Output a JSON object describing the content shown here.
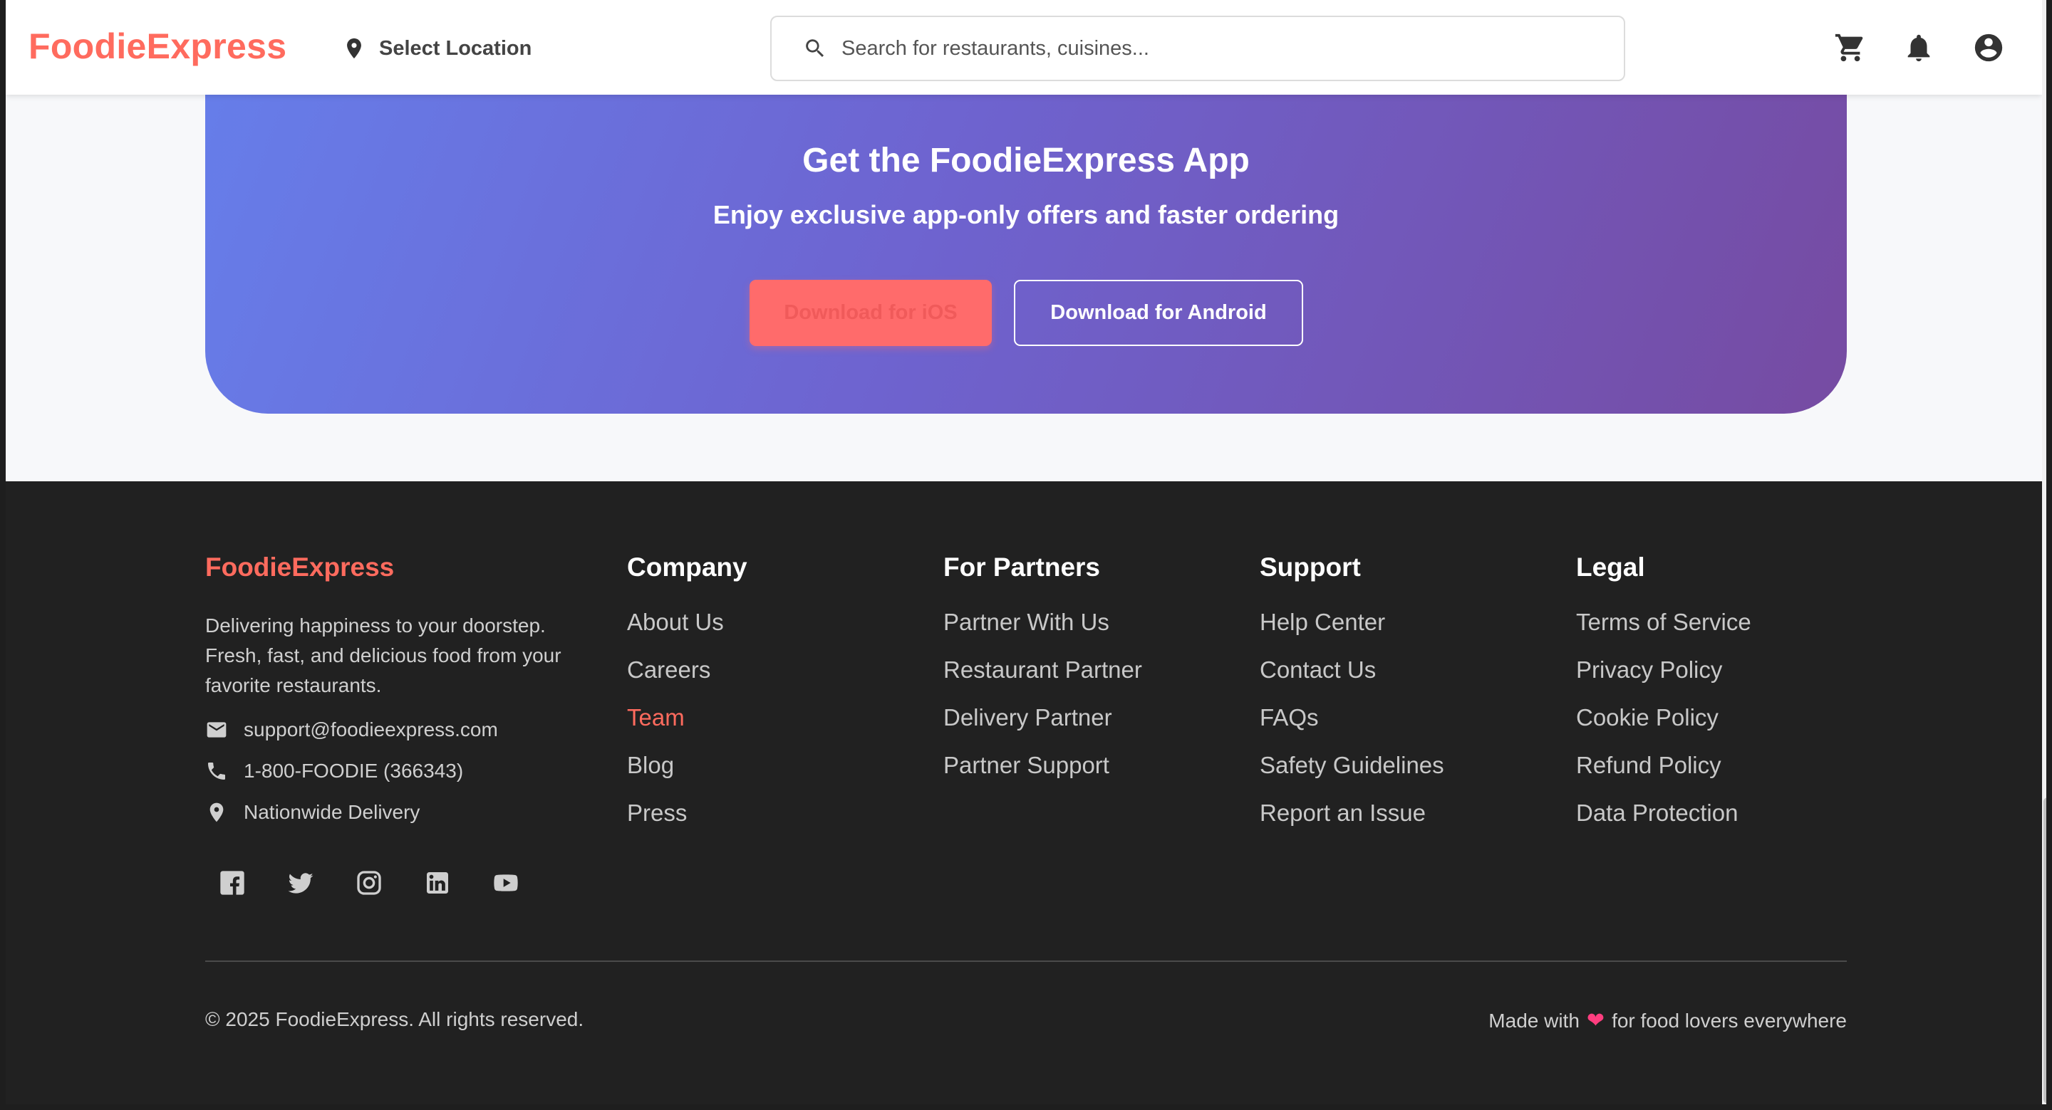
{
  "header": {
    "logo": "FoodieExpress",
    "location_label": "Select Location",
    "search_placeholder": "Search for restaurants, cuisines..."
  },
  "banner": {
    "title": "Get the FoodieExpress App",
    "subtitle": "Enjoy exclusive app-only offers and faster ordering",
    "ios_label": "Download for iOS",
    "android_label": "Download for Android"
  },
  "footer": {
    "brand": "FoodieExpress",
    "tagline": "Delivering happiness to your doorstep. Fresh, fast, and delicious food from your favorite restaurants.",
    "email": "support@foodieexpress.com",
    "phone": "1-800-FOODIE (366343)",
    "delivery": "Nationwide Delivery",
    "columns": [
      {
        "title": "Company",
        "links": [
          "About Us",
          "Careers",
          "Team",
          "Blog",
          "Press"
        ]
      },
      {
        "title": "For Partners",
        "links": [
          "Partner With Us",
          "Restaurant Partner",
          "Delivery Partner",
          "Partner Support"
        ]
      },
      {
        "title": "Support",
        "links": [
          "Help Center",
          "Contact Us",
          "FAQs",
          "Safety Guidelines",
          "Report an Issue"
        ]
      },
      {
        "title": "Legal",
        "links": [
          "Terms of Service",
          "Privacy Policy",
          "Cookie Policy",
          "Refund Policy",
          "Data Protection"
        ]
      }
    ],
    "copyright": "© 2025 FoodieExpress. All rights reserved.",
    "made_prefix": "Made with",
    "made_suffix": "for food lovers everywhere"
  },
  "colors": {
    "brand": "#ff6b5e",
    "banner_start": "#667eea",
    "banner_end": "#764ba2",
    "footer_bg": "#212121"
  },
  "icons": [
    "location-pin-icon",
    "search-icon",
    "cart-icon",
    "bell-icon",
    "account-icon",
    "email-icon",
    "phone-icon",
    "facebook-icon",
    "twitter-icon",
    "instagram-icon",
    "linkedin-icon",
    "youtube-icon",
    "heart-icon"
  ]
}
